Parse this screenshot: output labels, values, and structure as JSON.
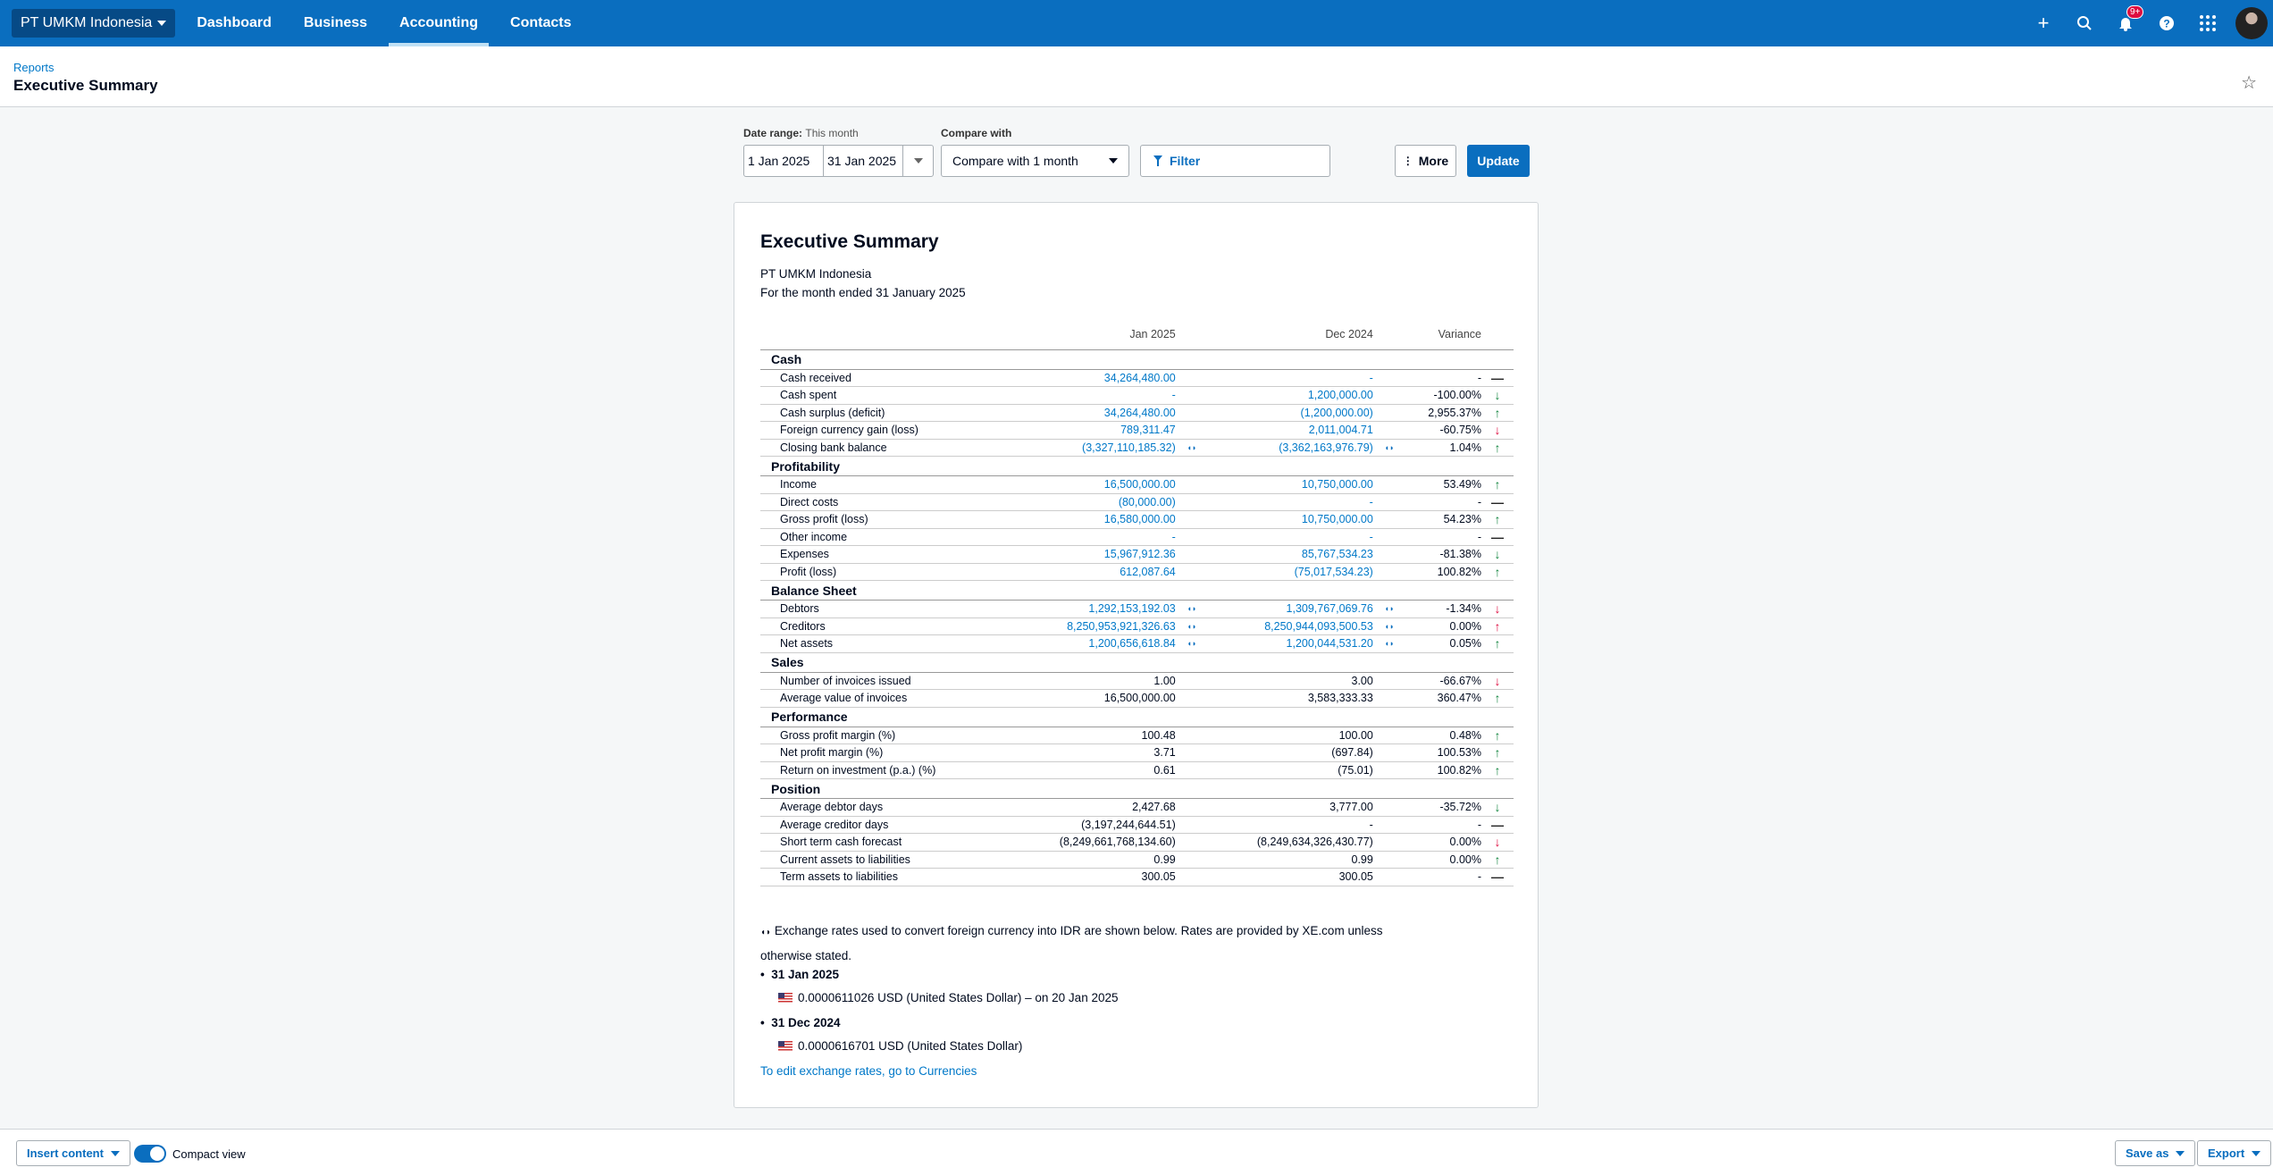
{
  "nav": {
    "org": "PT UMKM Indonesia",
    "items": [
      "Dashboard",
      "Business",
      "Accounting",
      "Contacts"
    ],
    "active": "Accounting",
    "notification_badge": "9+",
    "icons": [
      "plus-icon",
      "search-icon",
      "bell-icon",
      "help-icon",
      "apps-grid-icon",
      "avatar"
    ]
  },
  "header": {
    "breadcrumb": "Reports",
    "title": "Executive Summary"
  },
  "controls": {
    "date_range_label": "Date range:",
    "date_range_value": "This month",
    "from": "1 Jan 2025",
    "to": "31 Jan 2025",
    "compare_label": "Compare with",
    "compare_value": "Compare with 1 month",
    "filter": "Filter",
    "more": "More",
    "update": "Update"
  },
  "report": {
    "title": "Executive Summary",
    "org": "PT UMKM Indonesia",
    "period": "For the month ended 31 January 2025",
    "columns": [
      "Jan 2025",
      "Dec 2024",
      "Variance"
    ],
    "sections": [
      {
        "name": "Cash",
        "rows": [
          {
            "label": "Cash received",
            "jan": "34,264,480.00",
            "dec": "-",
            "var": "-",
            "trend": "flat",
            "link": true
          },
          {
            "label": "Cash spent",
            "jan": "-",
            "dec": "1,200,000.00",
            "var": "-100.00%",
            "trend": "down",
            "tone": "good",
            "link": true
          },
          {
            "label": "Cash surplus (deficit)",
            "jan": "34,264,480.00",
            "dec": "(1,200,000.00)",
            "var": "2,955.37%",
            "trend": "up",
            "tone": "good",
            "link": true
          },
          {
            "label": "Foreign currency gain (loss)",
            "jan": "789,311.47",
            "dec": "2,011,004.71",
            "var": "-60.75%",
            "trend": "down",
            "tone": "bad",
            "link": true
          },
          {
            "label": "Closing bank balance",
            "jan": "(3,327,110,185.32)",
            "dec": "(3,362,163,976.79)",
            "var": "1.04%",
            "trend": "up",
            "tone": "good",
            "link": true,
            "fx": true
          }
        ]
      },
      {
        "name": "Profitability",
        "rows": [
          {
            "label": "Income",
            "jan": "16,500,000.00",
            "dec": "10,750,000.00",
            "var": "53.49%",
            "trend": "up",
            "tone": "good",
            "link": true
          },
          {
            "label": "Direct costs",
            "jan": "(80,000.00)",
            "dec": "-",
            "var": "-",
            "trend": "flat",
            "link": true
          },
          {
            "label": "Gross profit (loss)",
            "jan": "16,580,000.00",
            "dec": "10,750,000.00",
            "var": "54.23%",
            "trend": "up",
            "tone": "good",
            "link": true
          },
          {
            "label": "Other income",
            "jan": "-",
            "dec": "-",
            "var": "-",
            "trend": "flat",
            "link": true
          },
          {
            "label": "Expenses",
            "jan": "15,967,912.36",
            "dec": "85,767,534.23",
            "var": "-81.38%",
            "trend": "down",
            "tone": "good",
            "link": true
          },
          {
            "label": "Profit (loss)",
            "jan": "612,087.64",
            "dec": "(75,017,534.23)",
            "var": "100.82%",
            "trend": "up",
            "tone": "good",
            "link": true
          }
        ]
      },
      {
        "name": "Balance Sheet",
        "rows": [
          {
            "label": "Debtors",
            "jan": "1,292,153,192.03",
            "dec": "1,309,767,069.76",
            "var": "-1.34%",
            "trend": "down",
            "tone": "bad",
            "link": true,
            "fx": true
          },
          {
            "label": "Creditors",
            "jan": "8,250,953,921,326.63",
            "dec": "8,250,944,093,500.53",
            "var": "0.00%",
            "trend": "up",
            "tone": "bad",
            "link": true,
            "fx": true
          },
          {
            "label": "Net assets",
            "jan": "1,200,656,618.84",
            "dec": "1,200,044,531.20",
            "var": "0.05%",
            "trend": "up",
            "tone": "good",
            "link": true,
            "fx": true
          }
        ]
      },
      {
        "name": "Sales",
        "rows": [
          {
            "label": "Number of invoices issued",
            "jan": "1.00",
            "dec": "3.00",
            "var": "-66.67%",
            "trend": "down",
            "tone": "bad"
          },
          {
            "label": "Average value of invoices",
            "jan": "16,500,000.00",
            "dec": "3,583,333.33",
            "var": "360.47%",
            "trend": "up",
            "tone": "good"
          }
        ]
      },
      {
        "name": "Performance",
        "rows": [
          {
            "label": "Gross profit margin (%)",
            "jan": "100.48",
            "dec": "100.00",
            "var": "0.48%",
            "trend": "up",
            "tone": "good"
          },
          {
            "label": "Net profit margin (%)",
            "jan": "3.71",
            "dec": "(697.84)",
            "var": "100.53%",
            "trend": "up",
            "tone": "good"
          },
          {
            "label": "Return on investment (p.a.) (%)",
            "jan": "0.61",
            "dec": "(75.01)",
            "var": "100.82%",
            "trend": "up",
            "tone": "good"
          }
        ]
      },
      {
        "name": "Position",
        "rows": [
          {
            "label": "Average debtor days",
            "jan": "2,427.68",
            "dec": "3,777.00",
            "var": "-35.72%",
            "trend": "down",
            "tone": "good"
          },
          {
            "label": "Average creditor days",
            "jan": "(3,197,244,644.51)",
            "dec": "-",
            "var": "-",
            "trend": "flat"
          },
          {
            "label": "Short term cash forecast",
            "jan": "(8,249,661,768,134.60)",
            "dec": "(8,249,634,326,430.77)",
            "var": "0.00%",
            "trend": "down",
            "tone": "bad"
          },
          {
            "label": "Current assets to liabilities",
            "jan": "0.99",
            "dec": "0.99",
            "var": "0.00%",
            "trend": "up",
            "tone": "good"
          },
          {
            "label": "Term assets to liabilities",
            "jan": "300.05",
            "dec": "300.05",
            "var": "-",
            "trend": "flat"
          }
        ]
      }
    ],
    "fx_note": "Exchange rates used to convert foreign currency into IDR are shown below. Rates are provided by XE.com unless otherwise stated.",
    "fx_rates": [
      {
        "date": "31 Jan 2025",
        "rate": "0.0000611026 USD (United States Dollar) – on 20 Jan 2025"
      },
      {
        "date": "31 Dec 2024",
        "rate": "0.0000616701 USD (United States Dollar)"
      }
    ],
    "edit_link": "To edit exchange rates, go to Currencies"
  },
  "footer": {
    "insert": "Insert content",
    "compact": "Compact view",
    "compact_on": true,
    "save": "Save as",
    "export": "Export"
  },
  "colors": {
    "brand": "#0a6ebf",
    "good": "#13863f",
    "bad": "#de0e40",
    "link": "#0078c8"
  }
}
